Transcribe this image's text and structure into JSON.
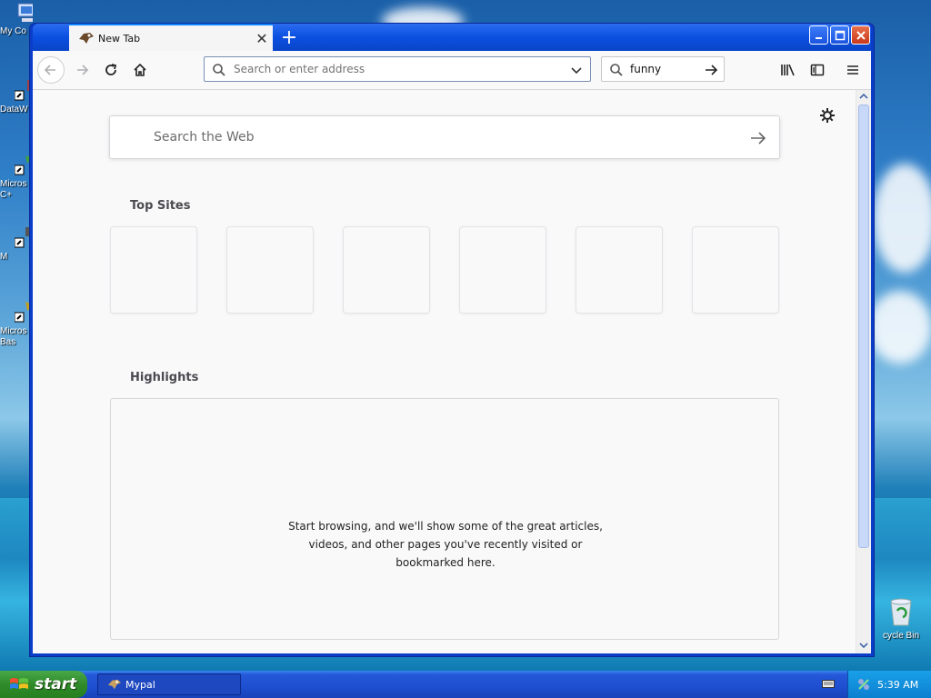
{
  "desktop": {
    "icons": [
      {
        "label": "My Co"
      },
      {
        "label": "DataW"
      },
      {
        "label": "Micros\nC+"
      },
      {
        "label": "M"
      },
      {
        "label": "Micros\nBas"
      }
    ],
    "recycle_bin_label": "cycle Bin"
  },
  "browser": {
    "tab": {
      "title": "New Tab"
    },
    "urlbar": {
      "placeholder": "Search or enter address",
      "value": ""
    },
    "searchbar": {
      "value": "funny"
    },
    "page": {
      "web_search_placeholder": "Search the Web",
      "top_sites_title": "Top Sites",
      "top_sites_count": 6,
      "highlights_title": "Highlights",
      "highlights_message": "Start browsing, and we'll show some of the great articles, videos, and other pages you've recently visited or bookmarked here."
    }
  },
  "taskbar": {
    "start_label": "start",
    "items": [
      {
        "label": "Mypal"
      }
    ],
    "clock": "5:39 AM"
  },
  "colors": {
    "accent": "#0a84ff",
    "xp_title_blue": "#0a45c8",
    "start_green": "#2f8a2a"
  }
}
